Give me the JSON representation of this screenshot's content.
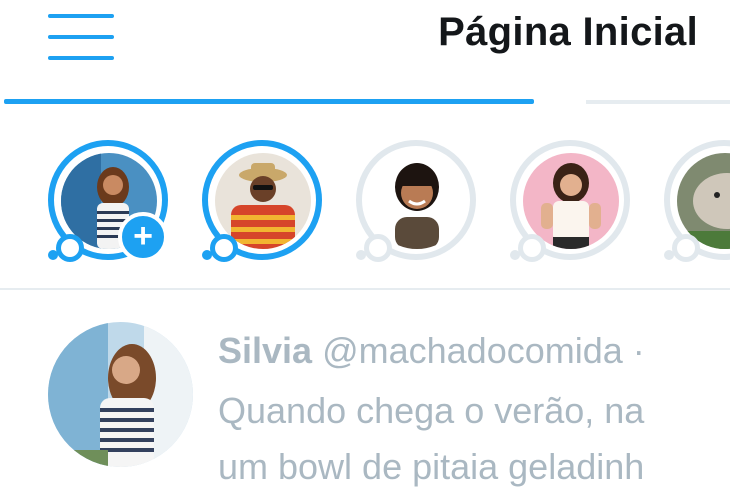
{
  "header": {
    "title": "Página Inicial",
    "menu_icon": "hamburger-menu-icon"
  },
  "colors": {
    "accent": "#1da1f2",
    "text_dark": "#14171a",
    "muted": "#aab8c2",
    "seen_ring": "#e1e8ed"
  },
  "fleets": [
    {
      "name": "own-fleet",
      "seen": false,
      "add": "+"
    },
    {
      "name": "fleet-2",
      "seen": false
    },
    {
      "name": "fleet-3",
      "seen": true
    },
    {
      "name": "fleet-4",
      "seen": true
    },
    {
      "name": "fleet-5",
      "seen": true
    }
  ],
  "tweet": {
    "display_name": "Silvia",
    "handle": "@machadocomida",
    "separator": "·",
    "text_line_1": "Quando chega o verão, na",
    "text_line_2": "um bowl de pitaia geladinh"
  }
}
